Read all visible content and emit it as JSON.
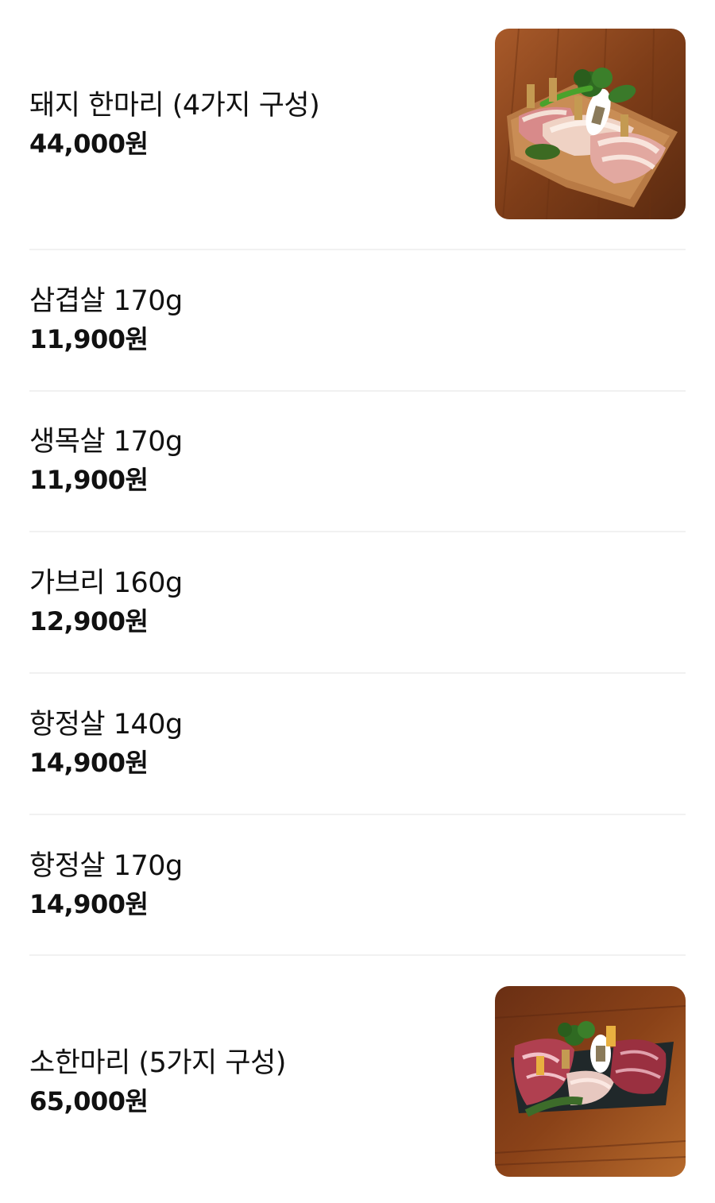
{
  "menu": {
    "items": [
      {
        "name": "돼지 한마리 (4가지 구성)",
        "price": "44,000원",
        "image": "pork-platter-photo"
      },
      {
        "name": "삼겹살 170g",
        "price": "11,900원"
      },
      {
        "name": "생목살 170g",
        "price": "11,900원"
      },
      {
        "name": "가브리 160g",
        "price": "12,900원"
      },
      {
        "name": "항정살 140g",
        "price": "14,900원"
      },
      {
        "name": "항정살 170g",
        "price": "14,900원"
      },
      {
        "name": "소한마리 (5가지 구성)",
        "price": "65,000원",
        "image": "beef-platter-photo"
      }
    ]
  }
}
